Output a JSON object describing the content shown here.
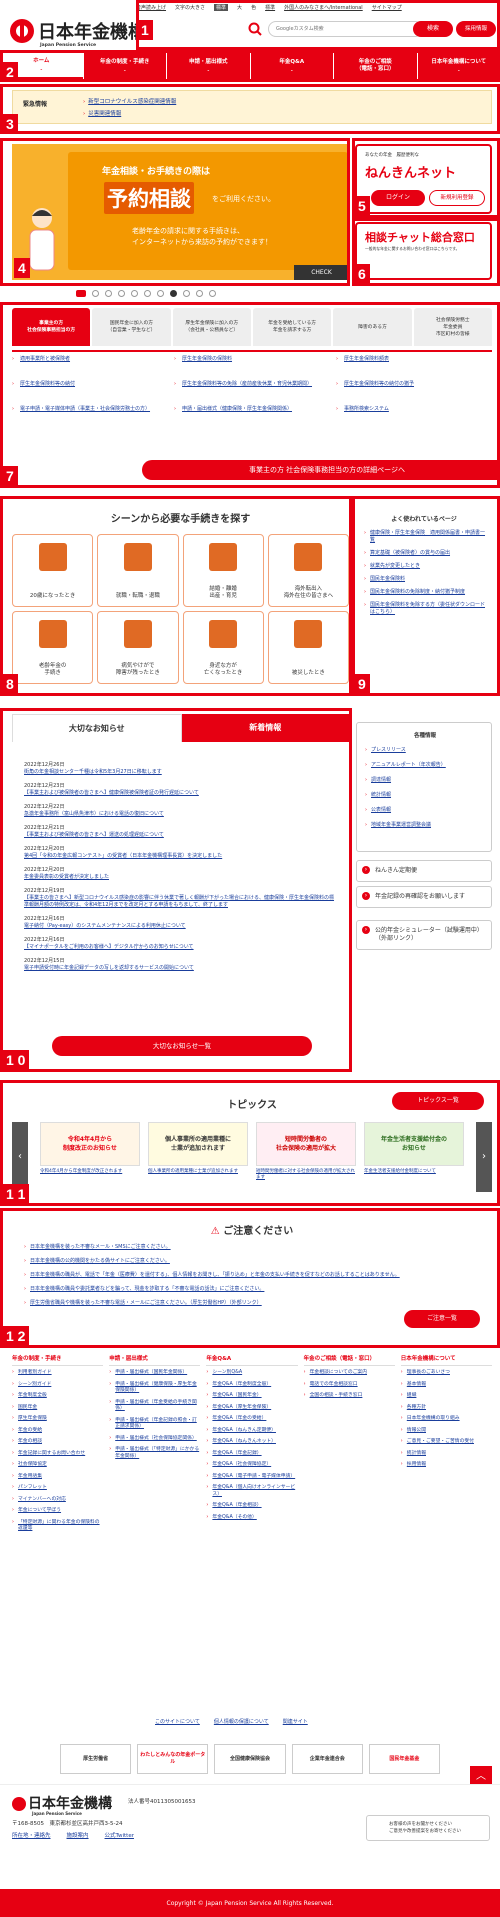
{
  "header": {
    "top_links": [
      "音声読み上げ",
      "文字の大きさ",
      "標準",
      "大",
      "色",
      "標準",
      "外国人のみなさまへ/International",
      "サイトマップ"
    ],
    "logo_title": "日本年金機構",
    "logo_sub": "Japan Pension Service",
    "search_placeholder": "Googleカスタム検索",
    "search_button": "検索",
    "recruit_button": "採用情報"
  },
  "nav": [
    {
      "label": "ホーム"
    },
    {
      "label": "年金の制度・手続き"
    },
    {
      "label": "申請・届出様式"
    },
    {
      "label": "年金Q&A"
    },
    {
      "label": "年金のご相談",
      "sub": "（電話・窓口）"
    },
    {
      "label": "日本年金機構について"
    }
  ],
  "emergency": {
    "label": "緊急情報",
    "items": [
      "新型コロナウイルス感染症関連情報",
      "災害関連情報"
    ]
  },
  "hero": {
    "line1": "年金相談・お手続きの際は",
    "line2": "予約相談",
    "line3": "をご利用ください。",
    "line4a": "老齢年金の請求に関する手続きは、",
    "line4b": "インターネットから来訪の予約ができます！",
    "check": "CHECK"
  },
  "nenkin_net": {
    "small": "あなたの年金　履歴便利な",
    "title": "ねんきんネット",
    "login": "ログイン",
    "register": "新規利用登録"
  },
  "chat": {
    "title": "相談チャット総合窓口",
    "desc": "一般的な年金に関するお問い合わせ窓口はこちらです。"
  },
  "tabs": [
    "事業主の方\n社会保険事務担当の方",
    "国民年金に加入の方\n（自営業・学生など）",
    "厚生年金保険に加入の方\n（会社員・公務員など）",
    "年金を受給している方\n年金を請求する方",
    "障害のある方",
    "社会保険労務士\n年金委員\n市区町村の皆様"
  ],
  "tab_links": [
    "適用事業所と被保険者",
    "厚生年金保険の保険料",
    "厚生年金保険料額表",
    "厚生年金保険料等の納付",
    "厚生年金保険料等の免除（産前産後休業・育児休業期間）",
    "厚生年金保険料等の納付の猶予",
    "電子申請・電子媒体申請（事業主・社会保険労務士の方）",
    "申請・届出様式（健康保険・厚生年金保険関係）",
    "事務所検索システム"
  ],
  "tab_button": "事業主の方 社会保険事務担当の方の詳細ページへ",
  "procedures": {
    "title": "シーンから必要な手続きを探す",
    "items": [
      "20歳になったとき",
      "就職・転職・退職",
      "結婚・離婚\n出産・育児",
      "海外転出入\n海外在住の皆さまへ",
      "老齢年金の\n手続き",
      "病気やけがで\n障害が残ったとき",
      "身近な方が\n亡くなったとき",
      "被災したとき"
    ]
  },
  "popular": {
    "title": "よく使われているページ",
    "items": [
      "健康保険・厚生年金保険　適用関係届書・申請書一覧",
      "算定基礎（被保険者）の賞与の届出",
      "就業先が変更したとき",
      "国民年金保険料",
      "国民年金保険料の免除制度・納付猶予制度",
      "国民年金保険料を免除する方（委任状ダウンロードはこちら）"
    ]
  },
  "news": {
    "tab_active": "大切なお知らせ",
    "tab_other": "新着情報",
    "items": [
      {
        "date": "2022年12月26日",
        "text": "街角の年金相談センター千種は令和5年3月27日に移転します"
      },
      {
        "date": "2022年12月23日",
        "text": "【事業主および被保険者の皆さまへ】健康保険被保険者証の発行遅延について"
      },
      {
        "date": "2022年12月22日",
        "text": "急激年金事務所（富山県魚津市）における電話の復旧について"
      },
      {
        "date": "2022年12月21日",
        "text": "【事業主および被保険者の皆さまへ】運送の処理遅延について"
      },
      {
        "date": "2022年12月20日",
        "text": "第4回「令和の年金広報コンテスト」の受賞者（日本年金機構理事長賞）を決定しました"
      },
      {
        "date": "2022年12月20日",
        "text": "年金委員表彰の受賞者が決定しました"
      },
      {
        "date": "2022年12月19日",
        "text": "【事業主の皆さまへ】新型コロナウイルス感染症の影響に伴う休業で著しく報酬が下がった場合における、健康保険・厚生年金保険料の標準報酬月額の特例改定は、令和4年12月までを改定月とする申請をもちまして、終了します"
      },
      {
        "date": "2022年12月16日",
        "text": "電子納付（Pay-easy）のシステムメンテナンスによる利用休止について"
      },
      {
        "date": "2022年12月16日",
        "text": "【マイナポータルをご利用のお客様へ】デジタル庁からのお知らせについて"
      },
      {
        "date": "2022年12月15日",
        "text": "電子申請受付時に年金記録データの写しを返却するサービスの開始について"
      }
    ],
    "button": "大切なお知らせ一覧"
  },
  "side": {
    "card_title": "各種情報",
    "card_items": [
      "プレスリリース",
      "アニュアルレポート（年次報告）",
      "調達情報",
      "統計情報",
      "公表情報",
      "地域年金事業運営調整会議"
    ],
    "boxes": [
      "ねんきん定期便",
      "年金記録の再確認をお願いします",
      "公的年金シミュレーター（試験運用中）（外部リンク）"
    ]
  },
  "topics": {
    "title": "トピックス",
    "button": "トピックス一覧",
    "cards": [
      {
        "img": "令和4年4月から\n制度改正のお知らせ",
        "cap": "令和4年4月から年金制度が改正されます"
      },
      {
        "img": "個人事業所の適用業種に\n士業が追加されます",
        "cap": "個人事業所の適用業種に士業が追加されます"
      },
      {
        "img": "短時間労働者の\n社会保険の適用が拡大",
        "cap": "短時間労働者に対する社会保険の適用が拡大されます"
      },
      {
        "img": "年金生活者支援給付金の\nお知らせ",
        "cap": "年金生活者支援給付金制度について"
      }
    ]
  },
  "caution": {
    "title": "ご注意ください",
    "items": [
      "日本年金機構を装った不審なメール・SMSにご注意ください。",
      "日本年金機構の公的機関をかたる偽サイトにご注意ください。",
      "日本年金機構の職員が、電話で「年金（医療費）を還付する」、個人情報をお聞きし、「振り込め」と年金の支払い手続きを促すなどのお話しすることはありません。",
      "日本年金機構の職員や委託業者などを騙って、現金を詐取する「不審な電話の話法」にご注意ください。",
      "厚生労働省職員や機構を装った不審な電話・メールにご注意ください。（厚生労働省HP）（外部リンク）"
    ],
    "button": "ご注意一覧"
  },
  "sitemap": [
    {
      "title": "年金の制度・手続き",
      "items": [
        "利用者別ガイド",
        "シーン別ガイド",
        "年金制度全般",
        "国民年金",
        "厚生年金保険",
        "年金の受給",
        "年金の相談",
        "年金記録に関するお問い合わせ",
        "社会保障協定",
        "年金用語集",
        "パンフレット",
        "マイナンバーへの対応",
        "年金について学ぼう",
        "「特定財源」に関わる年金の保険料の返還等"
      ]
    },
    {
      "title": "申請・届出様式",
      "items": [
        "申請・届出様式（国民年金関係）",
        "申請・届出様式（健康保険・厚生年金保険関係）",
        "申請・届出様式（年金受給の手続き関係）",
        "申請・届出様式（年金記録の照会・訂正請求関係）",
        "申請・届出様式（社会保障協定関係）",
        "申請・届出様式（「特定財源」にかかる年金関係）"
      ]
    },
    {
      "title": "年金Q&A",
      "items": [
        "シーン別Q&A",
        "年金Q&A（年金制度全般）",
        "年金Q&A（国民年金）",
        "年金Q&A（厚生年金保険）",
        "年金Q&A（年金の受給）",
        "年金Q&A（ねんきん定期便）",
        "年金Q&A（ねんきんネット）",
        "年金Q&A（年金記録）",
        "年金Q&A（社会保障協定）",
        "年金Q&A（電子申請・電子媒体申請）",
        "年金Q&A（個人向けオンラインサービス）",
        "年金Q&A（年金相談）",
        "年金Q&A（その他）"
      ]
    },
    {
      "title": "年金のご相談（電話・窓口）",
      "items": [
        "年金相談についてのご案内",
        "電話での年金相談窓口",
        "全国の相談・手続き窓口"
      ]
    },
    {
      "title": "日本年金機構について",
      "items": [
        "理事長のごあいさつ",
        "基本情報",
        "組織",
        "各種方針",
        "日本年金機構の取り組み",
        "情報公開",
        "ご意見・ご要望・ご苦情の受付",
        "統計情報",
        "採用情報"
      ]
    }
  ],
  "bottom_links": [
    "このサイトについて",
    "個人情報の保護について",
    "関連サイト"
  ],
  "banners": [
    "厚生労働省",
    "わたしとみんなの年金ポータル",
    "全国健康保険協会",
    "企業年金連合会",
    "国民年金基金"
  ],
  "footer": {
    "logo": "日本年金機構",
    "logo_sub": "Japan Pension Service",
    "corp_no": "法人番号4011305001653",
    "address": "〒168-8505　東京都杉並区高井戸西3-5-24",
    "links": [
      "所在地・連絡先",
      "施設案内",
      "公式Twitter"
    ],
    "feedback": "お客様の声をお聞かせください\nご意見や改善提案をお寄せください",
    "copyright": "Copyright © Japan Pension Service All Rights Reserved."
  },
  "markers": [
    "1",
    "2",
    "3",
    "4",
    "5",
    "6",
    "7",
    "8",
    "9",
    "1 0",
    "1 1",
    "1 2"
  ]
}
